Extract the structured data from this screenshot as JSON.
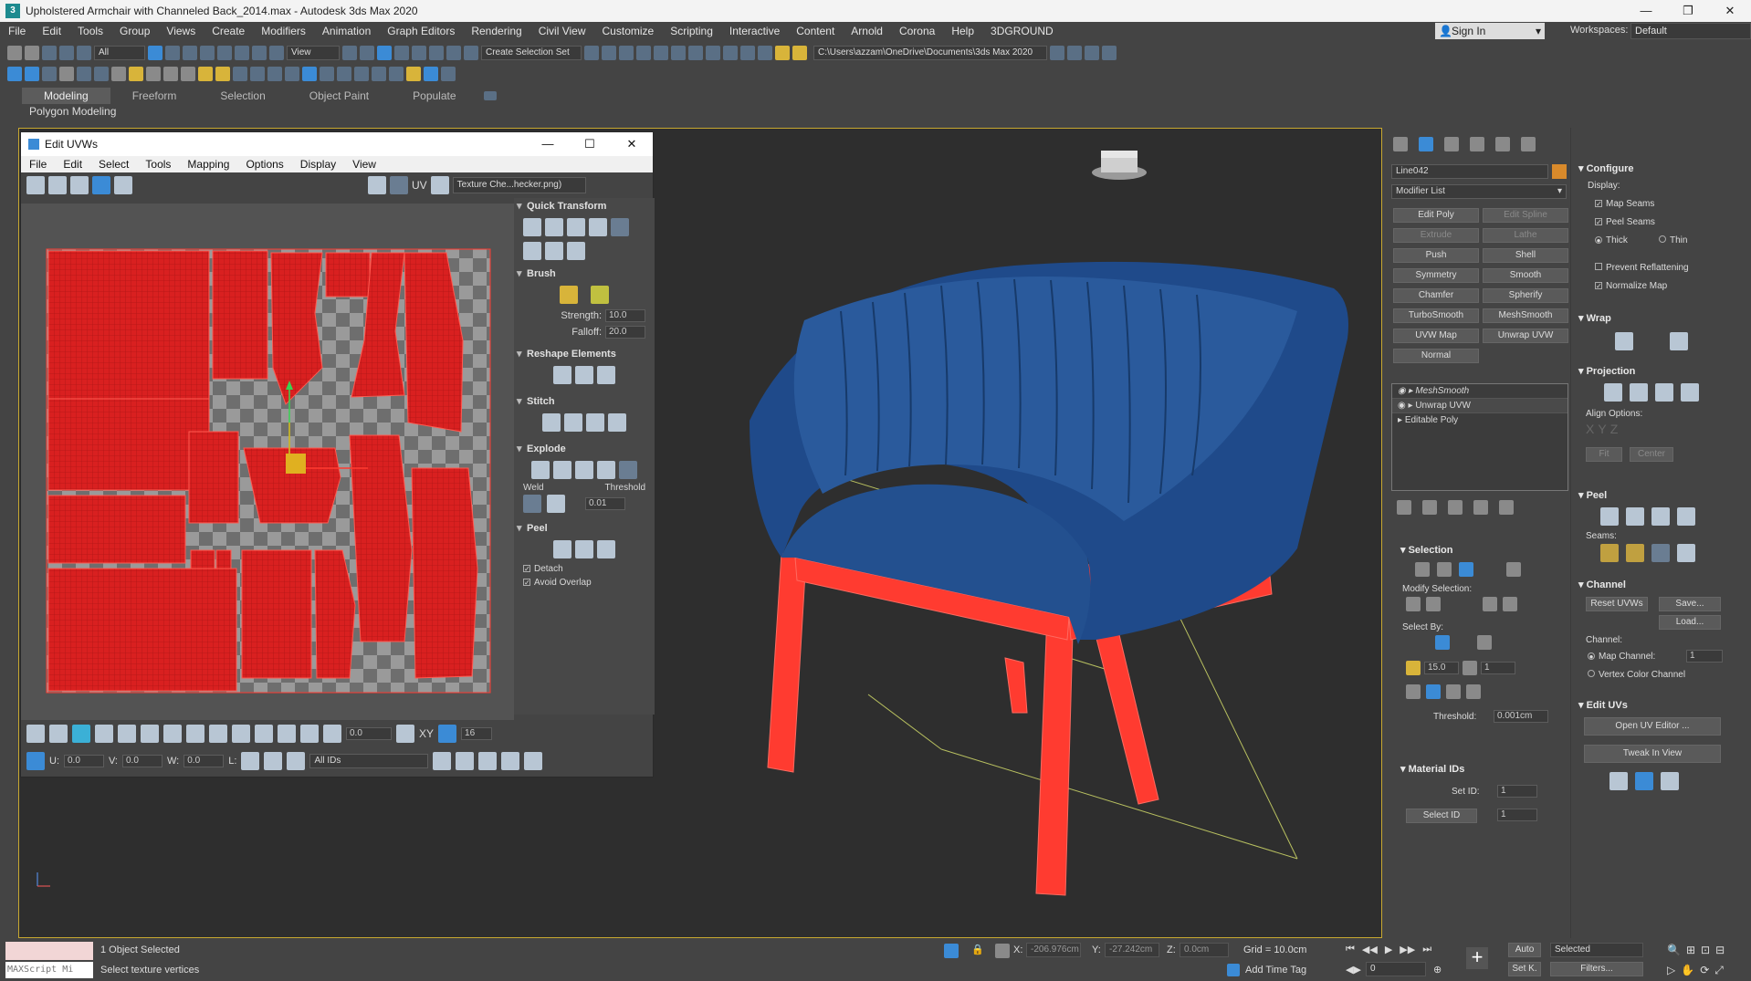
{
  "titlebar": {
    "title": "Upholstered Armchair with Channeled Back_2014.max - Autodesk 3ds Max 2020",
    "app_icon": "3ds-max-icon"
  },
  "menubar": {
    "items": [
      "File",
      "Edit",
      "Tools",
      "Group",
      "Views",
      "Create",
      "Modifiers",
      "Animation",
      "Graph Editors",
      "Rendering",
      "Civil View",
      "Customize",
      "Scripting",
      "Interactive",
      "Content",
      "Arnold",
      "Corona",
      "Help",
      "3DGROUND"
    ],
    "signin": "Sign In",
    "workspaces_label": "Workspaces:",
    "workspaces_value": "Default"
  },
  "toolbar": {
    "selection_filter": "All",
    "ref_coord": "View",
    "selection_set": "Create Selection Set",
    "project_path": "C:\\Users\\azzam\\OneDrive\\Documents\\3ds Max 2020"
  },
  "ribbon": {
    "tabs": [
      "Modeling",
      "Freeform",
      "Selection",
      "Object Paint",
      "Populate"
    ],
    "active_tab": "Modeling",
    "sub": "Polygon Modeling"
  },
  "uvw_window": {
    "title": "Edit UVWs",
    "menu": [
      "File",
      "Edit",
      "Select",
      "Tools",
      "Mapping",
      "Options",
      "Display",
      "View"
    ],
    "uv_label": "UV",
    "texture_dropdown": "Texture Che...hecker.png)",
    "quick_transform": "Quick Transform",
    "brush": "Brush",
    "strength_label": "Strength:",
    "strength_value": "10.0",
    "falloff_label": "Falloff:",
    "falloff_value": "20.0",
    "reshape": "Reshape Elements",
    "stitch": "Stitch",
    "explode": "Explode",
    "weld": "Weld",
    "threshold_label": "Threshold",
    "threshold_value": "0.01",
    "peel": "Peel",
    "detach": "Detach",
    "avoid_overlap": "Avoid Overlap",
    "angle_value": "0.0",
    "xy_label": "XY",
    "grid_value": "16",
    "u_label": "U:",
    "u_value": "0.0",
    "v_label": "V:",
    "v_value": "0.0",
    "w_label": "W:",
    "w_value": "0.0",
    "l_label": "L:",
    "ids_value": "All IDs"
  },
  "command_panel": {
    "object_name": "Line042",
    "object_color": "#d98a2b",
    "modifier_list": "Modifier List",
    "mod_buttons": [
      {
        "label": "Edit Poly",
        "disabled": false
      },
      {
        "label": "Edit Spline",
        "disabled": true
      },
      {
        "label": "Extrude",
        "disabled": true
      },
      {
        "label": "Lathe",
        "disabled": true
      },
      {
        "label": "Push",
        "disabled": false
      },
      {
        "label": "Shell",
        "disabled": false
      },
      {
        "label": "Symmetry",
        "disabled": false
      },
      {
        "label": "Smooth",
        "disabled": false
      },
      {
        "label": "Chamfer",
        "disabled": false
      },
      {
        "label": "Spherify",
        "disabled": false
      },
      {
        "label": "TurboSmooth",
        "disabled": false
      },
      {
        "label": "MeshSmooth",
        "disabled": false
      },
      {
        "label": "UVW Map",
        "disabled": false
      },
      {
        "label": "Unwrap UVW",
        "disabled": false
      },
      {
        "label": "Normal",
        "disabled": false
      }
    ],
    "stack": [
      "MeshSmooth",
      "Unwrap UVW",
      "Editable Poly"
    ],
    "selection_header": "Selection",
    "modify_selection": "Modify Selection:",
    "select_by": "Select By:",
    "angle_value": "15.0",
    "count_value": "1",
    "threshold_label": "Threshold:",
    "threshold_value": "0.001cm",
    "material_ids_header": "Material IDs",
    "set_id_label": "Set ID:",
    "set_id_value": "1",
    "select_id_label": "Select ID",
    "select_id_value": "1"
  },
  "mod_panel": {
    "configure": "Configure",
    "display_label": "Display:",
    "map_seams": "Map Seams",
    "peel_seams": "Peel Seams",
    "thick": "Thick",
    "thin": "Thin",
    "prevent_reflattening": "Prevent Reflattening",
    "normalize_map": "Normalize Map",
    "wrap": "Wrap",
    "projection": "Projection",
    "align_options": "Align Options:",
    "fit": "Fit",
    "center": "Center",
    "peel": "Peel",
    "seams_label": "Seams:",
    "channel": "Channel",
    "reset_uvws": "Reset UVWs",
    "save": "Save...",
    "load": "Load...",
    "channel_label": "Channel:",
    "map_channel": "Map Channel:",
    "map_channel_value": "1",
    "vertex_color_channel": "Vertex Color Channel",
    "edit_uvs": "Edit UVs",
    "open_uv_editor": "Open UV Editor ...",
    "tweak_in_view": "Tweak In View"
  },
  "statusbar": {
    "maxscript": "MAXScript Mi",
    "objects_selected": "1 Object Selected",
    "prompt": "Select texture vertices",
    "x_label": "X:",
    "x_value": "-206.976cm",
    "y_label": "Y:",
    "y_value": "-27.242cm",
    "z_label": "Z:",
    "z_value": "0.0cm",
    "grid": "Grid = 10.0cm",
    "add_time_tag": "Add Time Tag",
    "auto": "Auto",
    "set_key": "Set K.",
    "selected_dropdown": "Selected",
    "filters": "Filters...",
    "frame_value": "0"
  },
  "colors": {
    "chair_fabric": "#1f4a8a",
    "legs_selected": "#ff3b30",
    "uv_selected": "#e02020",
    "viewport_bg": "#2e2e2e"
  }
}
